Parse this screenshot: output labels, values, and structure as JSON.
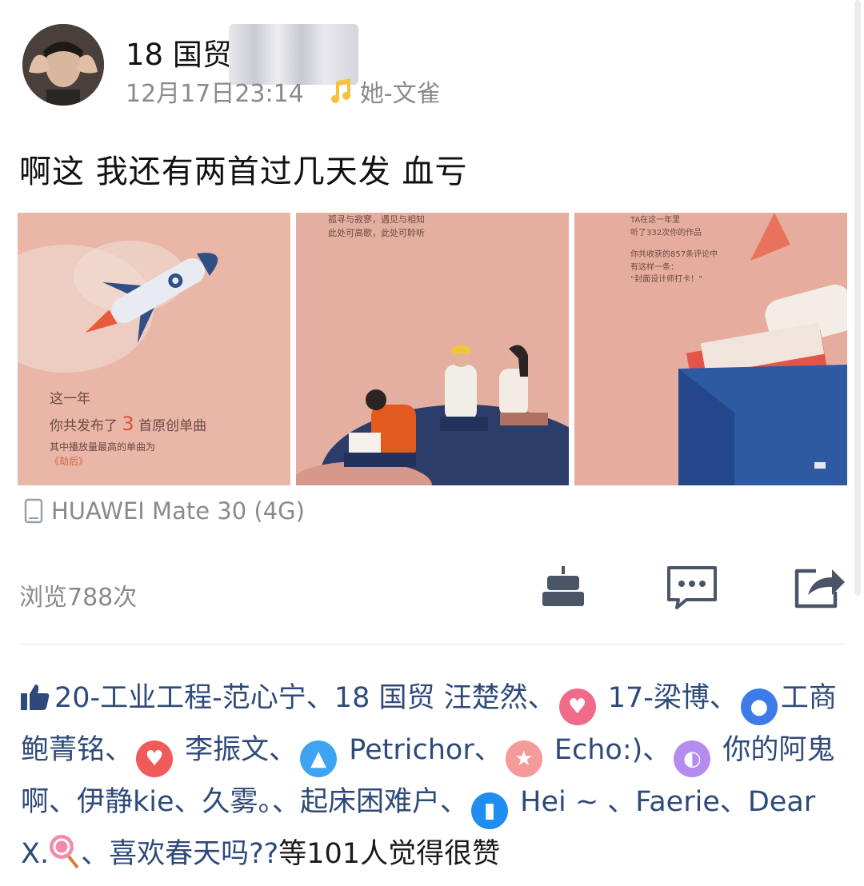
{
  "post": {
    "author": "18 国贸",
    "timestamp": "12月17日23:14",
    "music": "她-文雀",
    "text": "啊这 我还有两首过几天发  血亏",
    "device": "HUAWEI Mate 30 (4G)",
    "views": "浏览788次"
  },
  "photos": [
    {
      "lines": [
        "这一年",
        "你共发布了 3 首原创单曲",
        "其中播放量最高的单曲为",
        "《劫后》"
      ],
      "highlight": "3"
    },
    {
      "lines": [
        "孤寻与寂寥，遇见与相知",
        "此处可高歌，此处可聆听"
      ]
    },
    {
      "lines": [
        "TA在这一年里",
        "听了332次你的作品",
        "你共收获的857条评论中",
        "有这样一条：",
        "“封面设计师打卡！”"
      ]
    }
  ],
  "actions": [
    "cake-icon",
    "comment-icon",
    "share-icon"
  ],
  "likes": {
    "names": [
      "20-工业工程-范心宁、18 国贸 汪楚然、",
      " 17-梁博、",
      "工商 鲍菁铭、",
      " 李振文、",
      " Petrichor、",
      " Echo:)、",
      " 你的阿鬼啊、伊静kie、久雾。、起床困难户、",
      " Hei ~ 、Faerie、",
      "Dear X.",
      "、喜欢春天吗??"
    ],
    "suffix": "等101人觉得很赞"
  },
  "colors": {
    "text_link": "#2e4a7a",
    "secondary": "#8a8a8a",
    "photo_bg": "#e6b0a3",
    "badge_pink": "#f06a8a",
    "badge_blue": "#3d7be8",
    "badge_red": "#ef5a5a",
    "badge_lightblue": "#3ea4f2",
    "badge_salmon": "#f49a9a",
    "badge_purple": "#b48cf0"
  }
}
